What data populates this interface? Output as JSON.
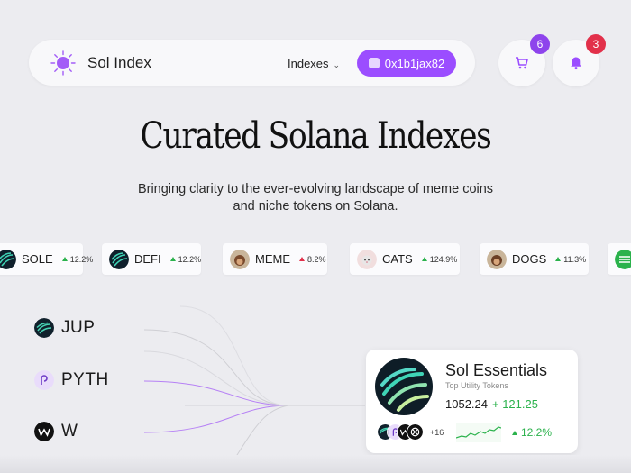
{
  "header": {
    "brand": "Sol Index",
    "nav_indexes": "Indexes",
    "wallet_address": "0x1b1jax82",
    "cart_count": "6",
    "notification_count": "3"
  },
  "hero": {
    "title": "Curated Solana Indexes",
    "subtitle": "Bringing clarity to the ever-evolving landscape of meme coins and niche tokens on Solana."
  },
  "tickers": [
    {
      "symbol": "SOLE",
      "change": "12.2%",
      "direction": "up",
      "icon": "stripes-icon"
    },
    {
      "symbol": "DEFI",
      "change": "12.2%",
      "direction": "up",
      "icon": "stripes-icon"
    },
    {
      "symbol": "MEME",
      "change": "8.2%",
      "direction": "down",
      "icon": "monkey-avatar-icon"
    },
    {
      "symbol": "CATS",
      "change": "124.9%",
      "direction": "up",
      "icon": "cat-avatar-icon"
    },
    {
      "symbol": "DOGS",
      "change": "11.3%",
      "direction": "up",
      "icon": "monkey-avatar-icon"
    },
    {
      "symbol": "",
      "change": "",
      "direction": "up",
      "icon": "green-stripes-icon"
    }
  ],
  "tokens": [
    {
      "symbol": "JUP",
      "icon": "jupiter-icon"
    },
    {
      "symbol": "PYTH",
      "icon": "pyth-icon"
    },
    {
      "symbol": "W",
      "icon": "wormhole-icon"
    }
  ],
  "index_card": {
    "name": "Sol Essentials",
    "subtitle": "Top Utility Tokens",
    "value": "1052.24",
    "delta": "+ 121.25",
    "more_count": "+16",
    "change_pct": "12.2%"
  },
  "colors": {
    "accent": "#9b4dff",
    "positive": "#2bb24c",
    "negative": "#e2304a",
    "background": "#ececf0"
  }
}
